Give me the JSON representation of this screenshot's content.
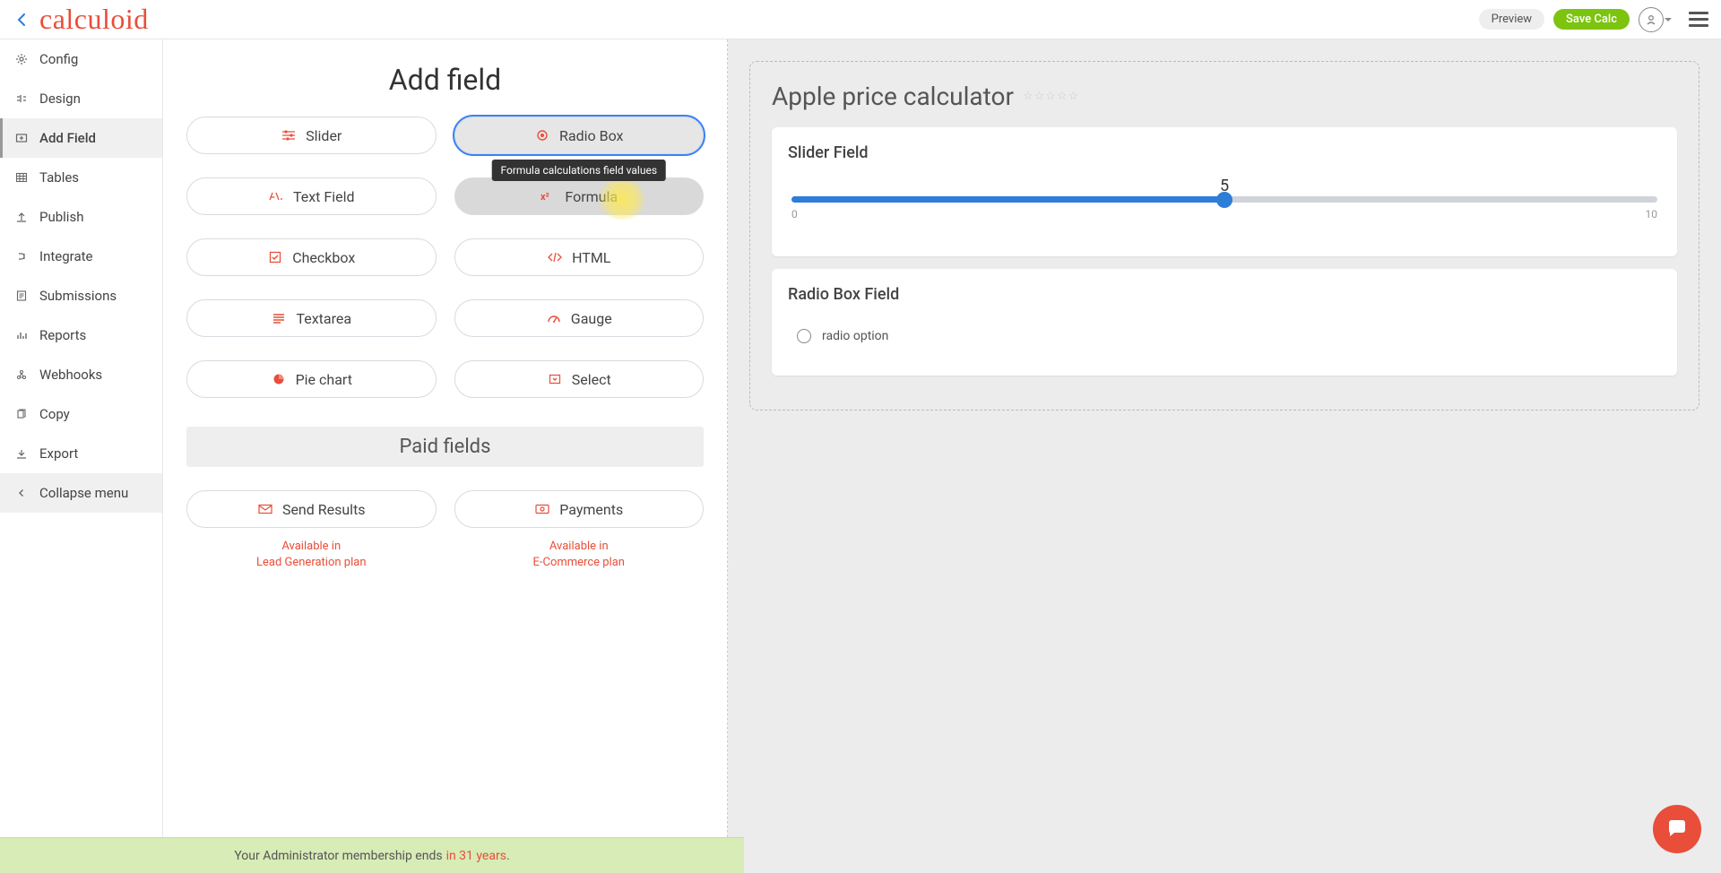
{
  "topbar": {
    "logo_text": "calculoid",
    "preview_label": "Preview",
    "save_label": "Save Calc"
  },
  "sidebar": {
    "items": [
      {
        "label": "Config"
      },
      {
        "label": "Design"
      },
      {
        "label": "Add Field",
        "active": true
      },
      {
        "label": "Tables"
      },
      {
        "label": "Publish"
      },
      {
        "label": "Integrate"
      },
      {
        "label": "Submissions"
      },
      {
        "label": "Reports"
      },
      {
        "label": "Webhooks"
      },
      {
        "label": "Copy"
      },
      {
        "label": "Export"
      }
    ],
    "collapse_label": "Collapse menu"
  },
  "center": {
    "heading": "Add field",
    "fields": {
      "slider": "Slider",
      "radio_box": "Radio Box",
      "text_field": "Text Field",
      "formula": "Formula",
      "checkbox": "Checkbox",
      "html": "HTML",
      "textarea": "Textarea",
      "gauge": "Gauge",
      "pie_chart": "Pie chart",
      "select": "Select",
      "send_results": "Send Results",
      "payments": "Payments"
    },
    "formula_tooltip": "Formula calculations field values",
    "paid_section": "Paid fields",
    "send_results_note_1": "Available in",
    "send_results_note_2": "Lead Generation plan",
    "payments_note_1": "Available in",
    "payments_note_2": "E-Commerce plan"
  },
  "preview": {
    "title": "Apple price calculator",
    "stars": "☆☆☆☆☆",
    "slider_field_title": "Slider Field",
    "slider_value": "5",
    "slider_min": "0",
    "slider_max": "10",
    "radio_field_title": "Radio Box Field",
    "radio_option_label": "radio option"
  },
  "footer": {
    "text_before": "Your Administrator membership ends ",
    "text_highlight": "in 31 years",
    "text_after": "."
  }
}
